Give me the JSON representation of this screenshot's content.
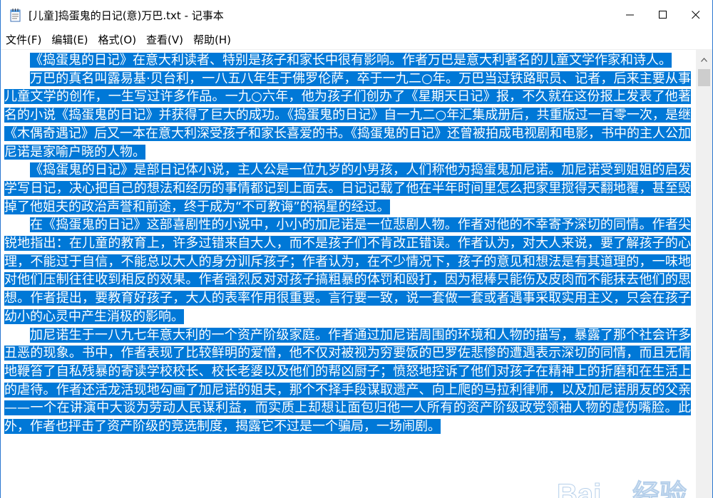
{
  "window": {
    "title": "[儿童]捣蛋鬼的日记(意)万巴.txt - 记事本"
  },
  "menu": {
    "items": [
      {
        "label": "文件(F)"
      },
      {
        "label": "编辑(E)"
      },
      {
        "label": "格式(O)"
      },
      {
        "label": "查看(V)"
      },
      {
        "label": "帮助(H)"
      }
    ]
  },
  "document": {
    "paragraphs": [
      "《捣蛋鬼的日记》在意大利读者、特别是孩子和家长中很有影响。作者万巴是意大利著名的儿童文学作家和诗人。",
      "万巴的真名叫露易基·贝台利，一八五八年生于佛罗伦萨，卒于一九二○年。万巴当过铁路职员、记者，后来主要从事儿童文学的创作，一生写过许多作品。一九○六年，他为孩子们创办了《星期天日记》报，不久就在这份报上发表了他著名的小说《捣蛋鬼的日记》并获得了巨大的成功。《捣蛋鬼的日记》自一九二○年汇集成册后，共重版过一百零一次，是继《木偶奇遇记》后又一本在意大利深受孩子和家长喜爱的书。《捣蛋鬼的日记》还曾被拍成电视剧和电影，书中的主人公加尼诺是家喻户晓的人物。",
      "《捣蛋鬼的日记》是部日记体小说，主人公是一位九岁的小男孩，人们称他为捣蛋鬼加尼诺。加尼诺受到姐姐的启发学写日记，决心把自己的想法和经历的事情都记到上面去。日记记载了他在半年时间里怎么把家里搅得天翻地覆，甚至毁掉了他姐夫的政治声誉和前途，终于成为“不可教诲”的祸星的经过。",
      "在《捣蛋鬼的日记》这部喜剧性的小说中，小小的加尼诺是一位悲剧人物。作者对他的不幸寄予深切的同情。作者尖锐地指出：在儿童的教育上，许多过错来自大人，而不是孩子们不肯改正错误。作者认为，对大人来说，要了解孩子的心理，不能过于自信，不能总以大人的身分训斥孩子；作者认为，在不少情况下，孩子的意见和想法是有其道理的，一味地对他们压制往往收到相反的效果。作者强烈反对对孩子搞粗暴的体罚和殴打，因为棍棒只能伤及皮肉而不能抹去他们的思想。作者提出，要教育好孩子，大人的表率作用很重要。言行要一致，说一套做一套或者遇事采取实用主义，只会在孩子幼小的心灵中产生消极的影响。",
      "加尼诺生于一八九七年意大利的一个资产阶级家庭。作者通过加尼诺周围的环境和人物的描写，暴露了那个社会许多丑恶的现象。书中，作者表现了比较鲜明的爱憎，他不仅对被视为穷要饭的巴罗佐悲惨的遭遇表示深切的同情，而且无情地鞭笞了自私残暴的寄读学校校长、校长老婆以及他们的帮凶厨子；愤怒地控诉了他们对孩子在精神上的折磨和在生活上的虐待。作者还活龙活现地勾画了加尼诺的姐夫，那个不择手段谋取遗产、向上爬的马拉利律师，以及加尼诺朋友的父亲——一个在讲演中大谈为劳动人民谋利益，而实质上却想让面包归他一人所有的资产阶级政党领袖人物的虚伪嘴脸。此外，作者也抨击了资产阶级的竞选制度，揭露它不过是一个骗局，一场闹剧。"
    ]
  },
  "watermark": {
    "text": "Baidu 经验"
  },
  "colors": {
    "selection": "#0078d7",
    "selection_text": "#ffffff",
    "window_border": "#2b78d0",
    "scrollbar_track": "#f0f0f0",
    "scrollbar_thumb": "#cdcdcd"
  }
}
